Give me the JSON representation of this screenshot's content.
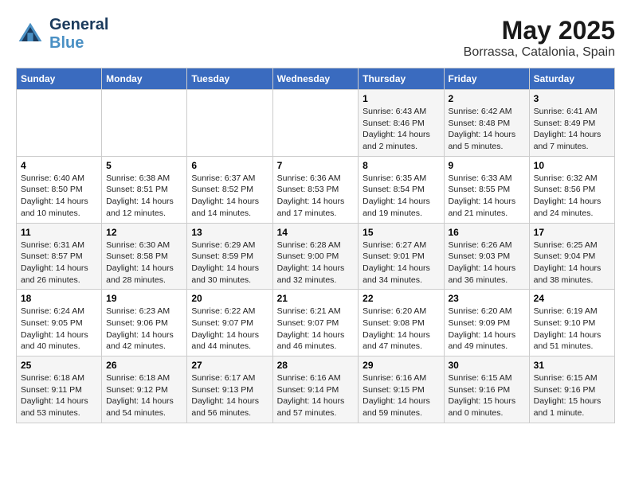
{
  "header": {
    "logo_line1": "General",
    "logo_line2": "Blue",
    "title": "May 2025",
    "subtitle": "Borrassa, Catalonia, Spain"
  },
  "days_of_week": [
    "Sunday",
    "Monday",
    "Tuesday",
    "Wednesday",
    "Thursday",
    "Friday",
    "Saturday"
  ],
  "weeks": [
    [
      {
        "num": "",
        "info": ""
      },
      {
        "num": "",
        "info": ""
      },
      {
        "num": "",
        "info": ""
      },
      {
        "num": "",
        "info": ""
      },
      {
        "num": "1",
        "info": "Sunrise: 6:43 AM\nSunset: 8:46 PM\nDaylight: 14 hours\nand 2 minutes."
      },
      {
        "num": "2",
        "info": "Sunrise: 6:42 AM\nSunset: 8:48 PM\nDaylight: 14 hours\nand 5 minutes."
      },
      {
        "num": "3",
        "info": "Sunrise: 6:41 AM\nSunset: 8:49 PM\nDaylight: 14 hours\nand 7 minutes."
      }
    ],
    [
      {
        "num": "4",
        "info": "Sunrise: 6:40 AM\nSunset: 8:50 PM\nDaylight: 14 hours\nand 10 minutes."
      },
      {
        "num": "5",
        "info": "Sunrise: 6:38 AM\nSunset: 8:51 PM\nDaylight: 14 hours\nand 12 minutes."
      },
      {
        "num": "6",
        "info": "Sunrise: 6:37 AM\nSunset: 8:52 PM\nDaylight: 14 hours\nand 14 minutes."
      },
      {
        "num": "7",
        "info": "Sunrise: 6:36 AM\nSunset: 8:53 PM\nDaylight: 14 hours\nand 17 minutes."
      },
      {
        "num": "8",
        "info": "Sunrise: 6:35 AM\nSunset: 8:54 PM\nDaylight: 14 hours\nand 19 minutes."
      },
      {
        "num": "9",
        "info": "Sunrise: 6:33 AM\nSunset: 8:55 PM\nDaylight: 14 hours\nand 21 minutes."
      },
      {
        "num": "10",
        "info": "Sunrise: 6:32 AM\nSunset: 8:56 PM\nDaylight: 14 hours\nand 24 minutes."
      }
    ],
    [
      {
        "num": "11",
        "info": "Sunrise: 6:31 AM\nSunset: 8:57 PM\nDaylight: 14 hours\nand 26 minutes."
      },
      {
        "num": "12",
        "info": "Sunrise: 6:30 AM\nSunset: 8:58 PM\nDaylight: 14 hours\nand 28 minutes."
      },
      {
        "num": "13",
        "info": "Sunrise: 6:29 AM\nSunset: 8:59 PM\nDaylight: 14 hours\nand 30 minutes."
      },
      {
        "num": "14",
        "info": "Sunrise: 6:28 AM\nSunset: 9:00 PM\nDaylight: 14 hours\nand 32 minutes."
      },
      {
        "num": "15",
        "info": "Sunrise: 6:27 AM\nSunset: 9:01 PM\nDaylight: 14 hours\nand 34 minutes."
      },
      {
        "num": "16",
        "info": "Sunrise: 6:26 AM\nSunset: 9:03 PM\nDaylight: 14 hours\nand 36 minutes."
      },
      {
        "num": "17",
        "info": "Sunrise: 6:25 AM\nSunset: 9:04 PM\nDaylight: 14 hours\nand 38 minutes."
      }
    ],
    [
      {
        "num": "18",
        "info": "Sunrise: 6:24 AM\nSunset: 9:05 PM\nDaylight: 14 hours\nand 40 minutes."
      },
      {
        "num": "19",
        "info": "Sunrise: 6:23 AM\nSunset: 9:06 PM\nDaylight: 14 hours\nand 42 minutes."
      },
      {
        "num": "20",
        "info": "Sunrise: 6:22 AM\nSunset: 9:07 PM\nDaylight: 14 hours\nand 44 minutes."
      },
      {
        "num": "21",
        "info": "Sunrise: 6:21 AM\nSunset: 9:07 PM\nDaylight: 14 hours\nand 46 minutes."
      },
      {
        "num": "22",
        "info": "Sunrise: 6:20 AM\nSunset: 9:08 PM\nDaylight: 14 hours\nand 47 minutes."
      },
      {
        "num": "23",
        "info": "Sunrise: 6:20 AM\nSunset: 9:09 PM\nDaylight: 14 hours\nand 49 minutes."
      },
      {
        "num": "24",
        "info": "Sunrise: 6:19 AM\nSunset: 9:10 PM\nDaylight: 14 hours\nand 51 minutes."
      }
    ],
    [
      {
        "num": "25",
        "info": "Sunrise: 6:18 AM\nSunset: 9:11 PM\nDaylight: 14 hours\nand 53 minutes."
      },
      {
        "num": "26",
        "info": "Sunrise: 6:18 AM\nSunset: 9:12 PM\nDaylight: 14 hours\nand 54 minutes."
      },
      {
        "num": "27",
        "info": "Sunrise: 6:17 AM\nSunset: 9:13 PM\nDaylight: 14 hours\nand 56 minutes."
      },
      {
        "num": "28",
        "info": "Sunrise: 6:16 AM\nSunset: 9:14 PM\nDaylight: 14 hours\nand 57 minutes."
      },
      {
        "num": "29",
        "info": "Sunrise: 6:16 AM\nSunset: 9:15 PM\nDaylight: 14 hours\nand 59 minutes."
      },
      {
        "num": "30",
        "info": "Sunrise: 6:15 AM\nSunset: 9:16 PM\nDaylight: 15 hours\nand 0 minutes."
      },
      {
        "num": "31",
        "info": "Sunrise: 6:15 AM\nSunset: 9:16 PM\nDaylight: 15 hours\nand 1 minute."
      }
    ]
  ]
}
